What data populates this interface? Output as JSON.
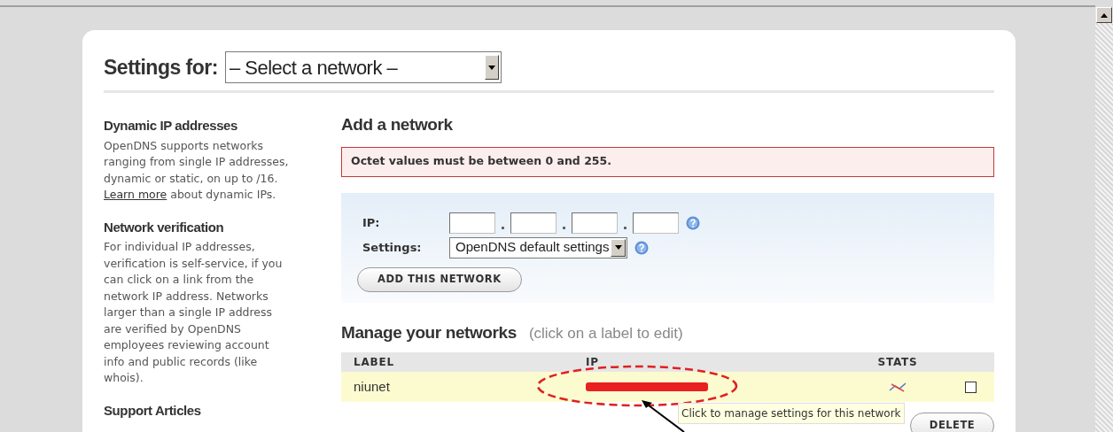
{
  "settings_for": {
    "label": "Settings for:",
    "select_value": "– Select a network –"
  },
  "sidebar": [
    {
      "title": "Dynamic IP addresses",
      "text_before": "OpenDNS supports networks ranging from single IP addresses, dynamic or static, on up to /16.",
      "link": "Learn more",
      "text_after": "about dynamic IPs."
    },
    {
      "title": "Network verification",
      "text_before": "For individual IP addresses, verification is self-service, if you can click on a link from the network IP address. Networks larger than a single IP address are verified by OpenDNS employees reviewing account info and public records (like whois)."
    },
    {
      "title": "Support Articles"
    }
  ],
  "add_network": {
    "title": "Add a network",
    "error": "Octet values must be between 0 and 255.",
    "ip_label": "IP:",
    "settings_label": "Settings:",
    "settings_value": "OpenDNS default settings",
    "button": "ADD THIS NETWORK"
  },
  "manage": {
    "title": "Manage your networks",
    "hint": "(click on a label to edit)",
    "columns": [
      "LABEL",
      "IP",
      "STATS"
    ],
    "rows": [
      {
        "label": "niunet",
        "checked": false
      }
    ],
    "tooltip": "Click to manage settings for this network",
    "delete_button": "DELETE"
  }
}
